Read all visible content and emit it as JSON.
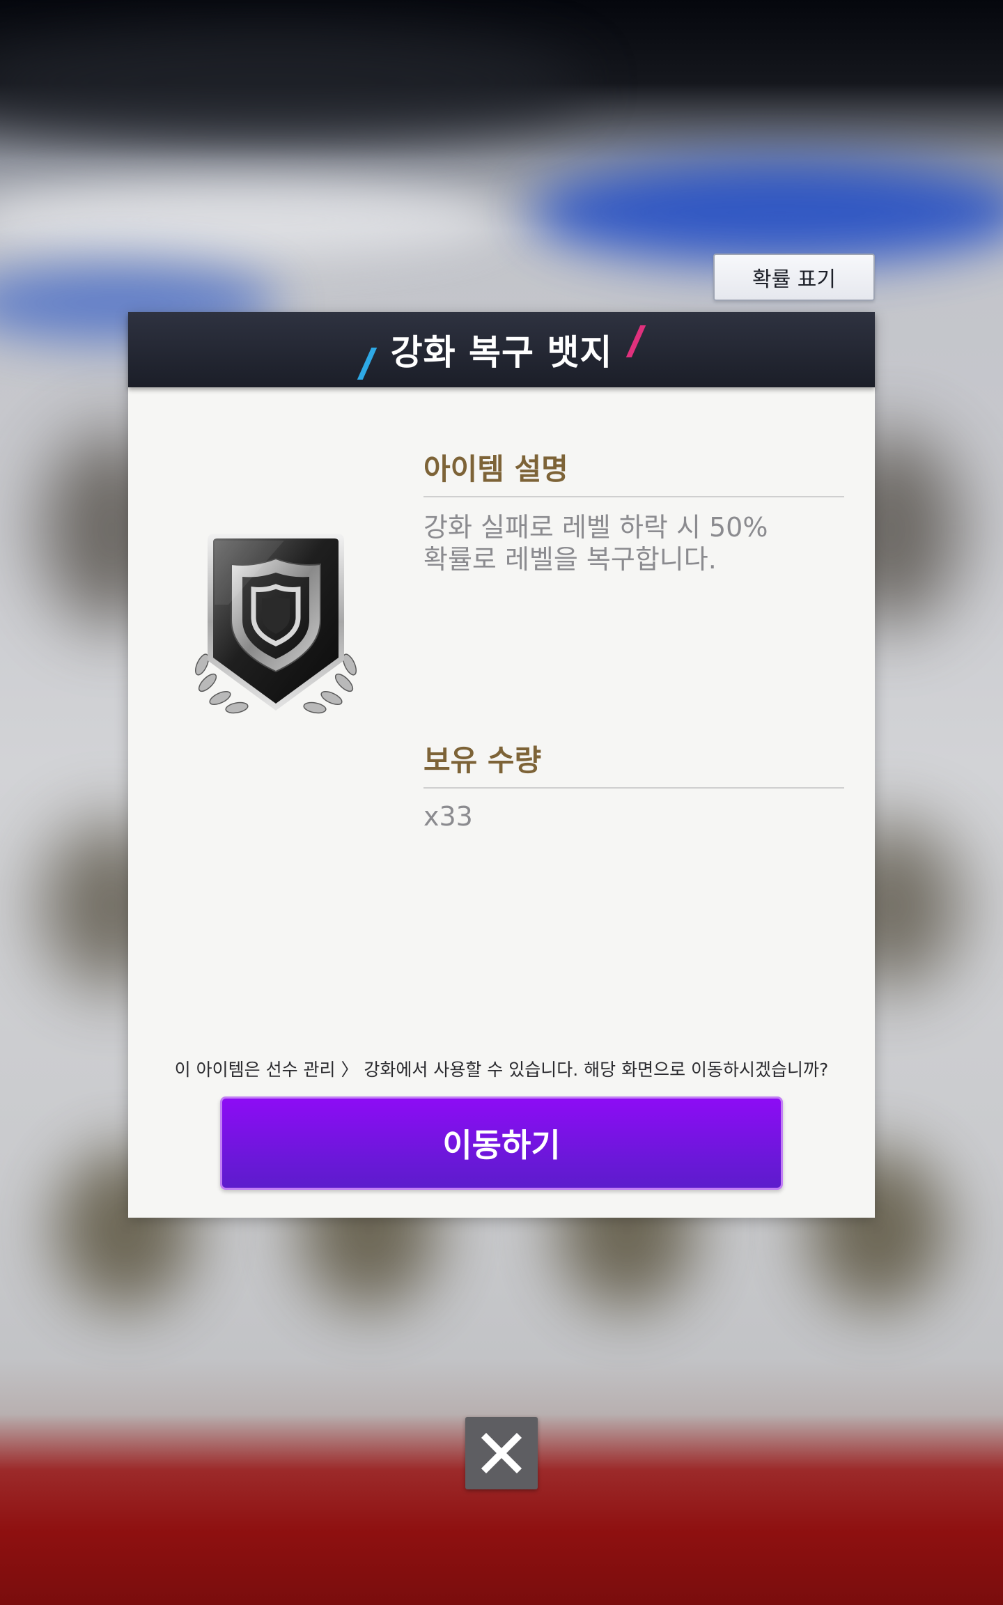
{
  "probability_button": {
    "label": "확률 표기"
  },
  "modal": {
    "title": "강화 복구 뱃지",
    "item_icon": "shield-badge-icon",
    "description": {
      "label": "아이템 설명",
      "line1": "강화 실패로 레벨 하락 시 50%",
      "line2": "확률로 레벨을 복구합니다."
    },
    "quantity": {
      "label": "보유 수량",
      "value": "x33"
    },
    "notice": "이 아이템은 선수 관리 〉 강화에서 사용할 수 있습니다. 해당 화면으로 이동하시겠습니까?",
    "action_button": {
      "label": "이동하기"
    }
  },
  "close_button": {
    "icon": "close-icon"
  },
  "colors": {
    "header_bg": "#232633",
    "section_label": "#7d6337",
    "action_button": "#7a14e8",
    "accent_blue": "#2ea9e6",
    "accent_pink": "#e0317d"
  }
}
